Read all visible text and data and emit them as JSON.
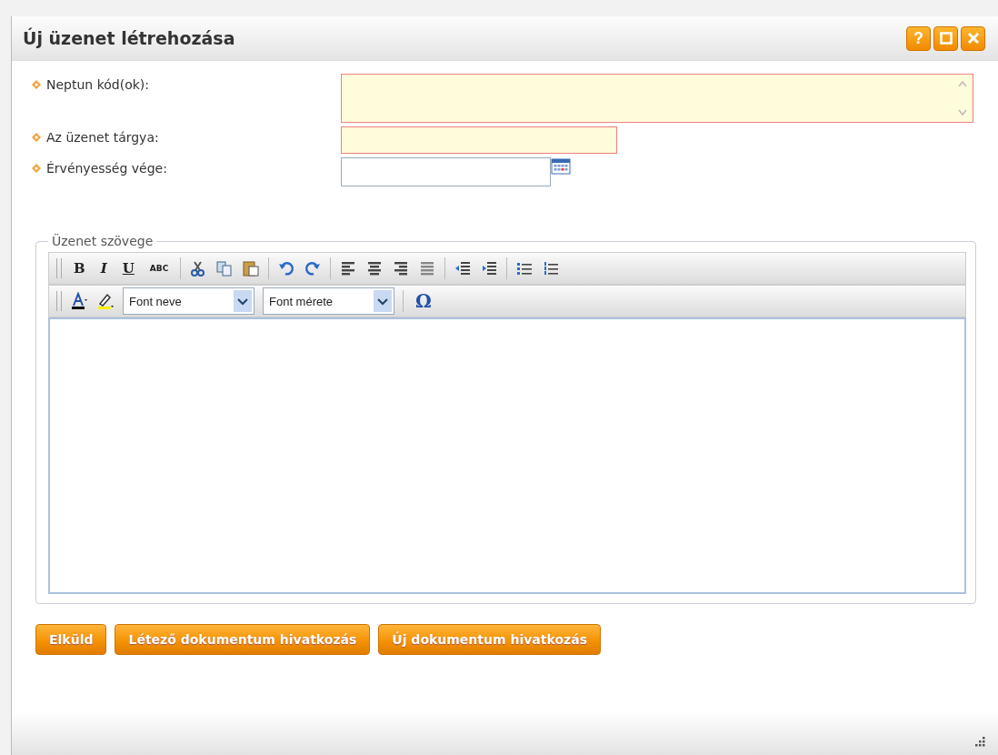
{
  "window": {
    "title": "Új üzenet létrehozása",
    "controls": [
      "?"
    ]
  },
  "fields": [
    {
      "kind": "textarea",
      "label": "Neptun kód(ok):",
      "invalid": true
    },
    {
      "kind": "text",
      "label": "Az üzenet tárgya:",
      "invalid": true
    },
    {
      "kind": "date",
      "label": "Érvényesség vége:",
      "invalid": false
    }
  ],
  "message": {
    "legend": "Üzenet szövege",
    "format_buttons": [
      "B",
      "I",
      "U",
      "ABC"
    ],
    "font_name": "Font neve",
    "font_size": "Font mérete",
    "symbol": "Ω"
  },
  "buttons": [
    "Elküld",
    "Létező dokumentum hivatkozás",
    "Új dokumentum hivatkozás"
  ]
}
